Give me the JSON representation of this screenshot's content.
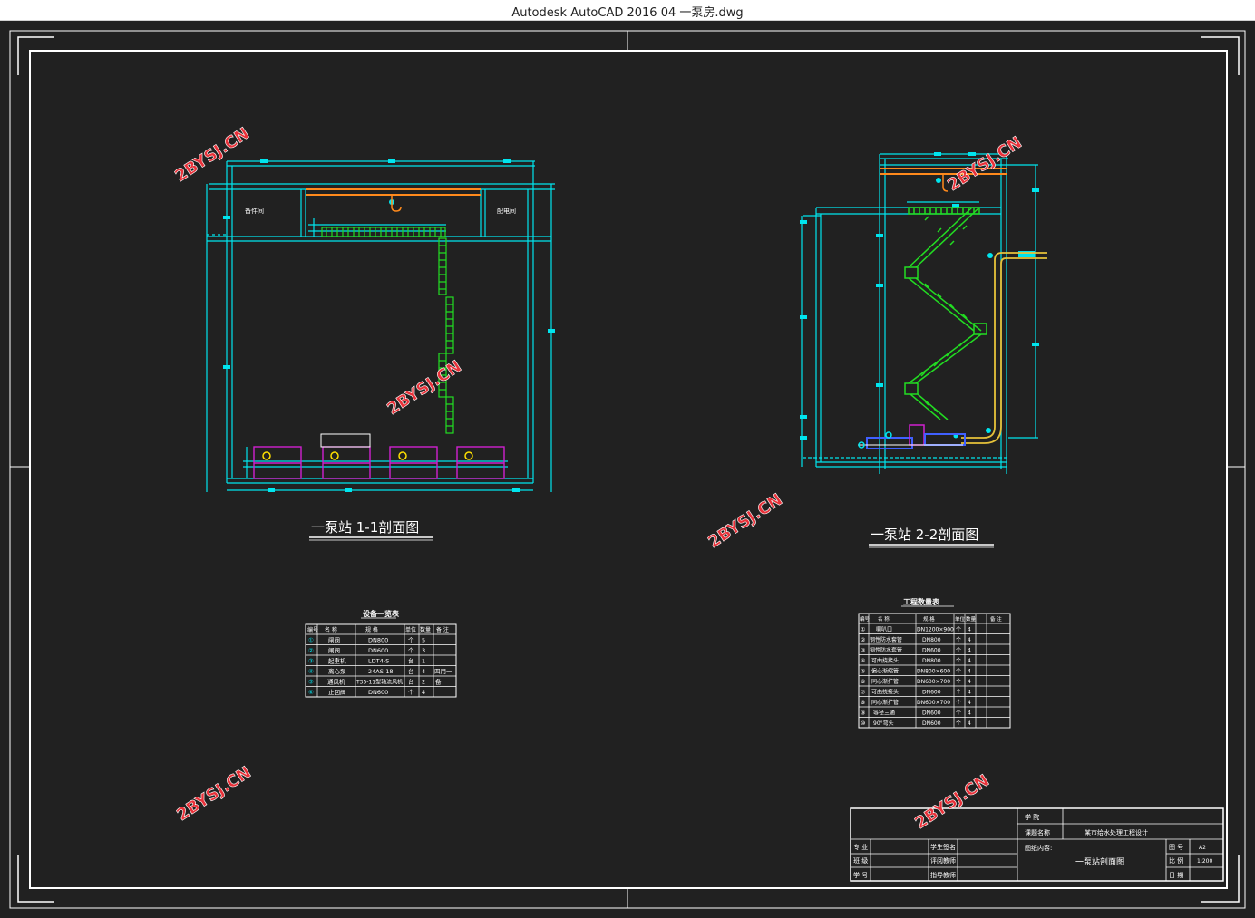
{
  "window": {
    "title": "Autodesk AutoCAD 2016     04 一泵房.dwg"
  },
  "drawing": {
    "section1_title": "一泵站 1-1剖面图",
    "section2_title": "一泵站 2-2剖面图",
    "room_left": "备件间",
    "room_right": "配电间",
    "watermark": "2BYSJ.CN"
  },
  "equip_table": {
    "title": "设备一览表",
    "headers": [
      "编号",
      "名  称",
      "规  格",
      "单位",
      "数量",
      "备 注"
    ],
    "rows": [
      [
        "①",
        "闸阀",
        "DN800",
        "个",
        "5",
        ""
      ],
      [
        "②",
        "闸阀",
        "DN600",
        "个",
        "3",
        ""
      ],
      [
        "③",
        "起重机",
        "LDT4-S",
        "台",
        "1",
        ""
      ],
      [
        "④",
        "离心泵",
        "24AS-18",
        "台",
        "4",
        "四用一"
      ],
      [
        "⑤",
        "通风机",
        "T35-11型轴流风机",
        "台",
        "2",
        "备"
      ],
      [
        "⑥",
        "止回阀",
        "DN600",
        "个",
        "4",
        ""
      ]
    ]
  },
  "work_table": {
    "title": "工程数量表",
    "headers": [
      "编号",
      "名  称",
      "规  格",
      "单位",
      "数量",
      "备 注"
    ],
    "rows": [
      [
        "①",
        "喇叭口",
        "DN1200×900",
        "个",
        "4",
        ""
      ],
      [
        "②",
        "钢性防水套管",
        "DN800",
        "个",
        "4",
        ""
      ],
      [
        "③",
        "钢性防水套管",
        "DN600",
        "个",
        "4",
        ""
      ],
      [
        "④",
        "可曲挠接头",
        "DN800",
        "个",
        "4",
        ""
      ],
      [
        "⑤",
        "偏心渐缩管",
        "DN800×600",
        "个",
        "4",
        ""
      ],
      [
        "⑥",
        "同心渐扩管",
        "DN600×700",
        "个",
        "4",
        ""
      ],
      [
        "⑦",
        "可曲挠接头",
        "DN600",
        "个",
        "4",
        ""
      ],
      [
        "⑧",
        "同心渐扩管",
        "DN600×700",
        "个",
        "4",
        ""
      ],
      [
        "⑨",
        "等径三通",
        "DN600",
        "个",
        "4",
        ""
      ],
      [
        "⑩",
        "90°弯头",
        "DN600",
        "个",
        "4",
        ""
      ]
    ]
  },
  "title_block": {
    "school": "学  院",
    "project_label": "课题名称",
    "project": "某市给水处理工程设计",
    "content_label": "图纸内容:",
    "content": "一泵站剖面图",
    "major": "专  业",
    "class": "班  级",
    "student_no": "学  号",
    "student_sig": "学生签名",
    "teacher_sig": "评阅教师",
    "advisor_sig": "指导教师",
    "drawing_no_label": "图  号",
    "drawing_no": "A2",
    "scale_label": "比  例",
    "scale": "1:200",
    "date_label": "日  期"
  },
  "colors": {
    "background": "#212121",
    "frame": "#ffffff",
    "structure": "#00e5ee",
    "stairs": "#22dd22",
    "pump": "#d020d0",
    "crane": "#ff8a1c",
    "pipe": "#e6c23a",
    "watermark": "#e8323a"
  }
}
